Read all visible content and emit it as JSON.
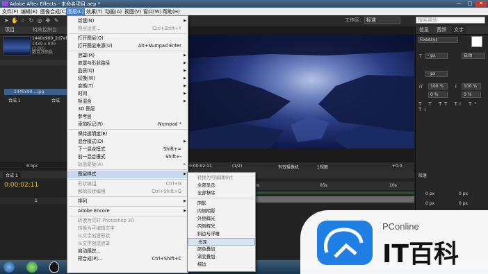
{
  "titlebar": {
    "title": "Adobe After Effects - 未命名项目.aep *",
    "min": "—",
    "max": "□",
    "close": "✕"
  },
  "menubar": {
    "items": [
      "文件(F)",
      "编辑(E)",
      "图像合成(C)",
      "图层(L)",
      "效果(T)",
      "动画(A)",
      "视图(V)",
      "窗口(W)",
      "帮助(H)"
    ]
  },
  "toolbar": {
    "workspace_label": "工作区:",
    "workspace_value": "标准",
    "search_placeholder": "搜索帮助"
  },
  "project": {
    "tab1": "项目",
    "tab2": "特效控制台",
    "file_name": "1440x900_2d7ef...",
    "file_info": "1439 x 900 (1.00)",
    "file_info2": "数百万颜色",
    "item1": "1440x90....jpg",
    "item2": "合成 1",
    "type1": "",
    "type2": "合成",
    "bpc": "8 bpc"
  },
  "viewer": {
    "zoom": "(1/2)",
    "camera": "有效摄像机",
    "views": "1视图",
    "time": "0:00:02:11",
    "offset": "+0.0"
  },
  "right_panel": {
    "tabs": [
      "信息",
      "音频",
      "文字"
    ],
    "font": "Fixedsys",
    "auto": "自动",
    "size_a": "- px",
    "size_b": "- px",
    "pct1": "100 %",
    "pct2": "100 %",
    "pct3": "0 %",
    "pct4": "0 %"
  },
  "timeline": {
    "tab": "合成 1",
    "time": "0:00:02:11",
    "layer_no": "1",
    "layer_mode": "正常",
    "ruler": [
      "0s",
      "05s",
      "10s"
    ],
    "right_tab": "段落",
    "right_values": [
      "0 px",
      "0 px",
      "0 px",
      "0 px"
    ]
  },
  "layer_menu": {
    "items": [
      {
        "label": "新建(N)",
        "sc": "",
        "arrow": true,
        "dis": false
      },
      {
        "label": "图层设置...",
        "sc": "Ctrl+Shift+Y",
        "arrow": false,
        "dis": true
      },
      {
        "sep": true
      },
      {
        "label": "打开图层(O)",
        "sc": "",
        "arrow": false,
        "dis": false
      },
      {
        "label": "打开图层来源(U)",
        "sc": "Alt+Numpad Enter",
        "arrow": false,
        "dis": false
      },
      {
        "sep": true
      },
      {
        "label": "遮罩(M)",
        "sc": "",
        "arrow": true,
        "dis": false
      },
      {
        "label": "遮罩与形状路径",
        "sc": "",
        "arrow": true,
        "dis": false
      },
      {
        "label": "品质(Q)",
        "sc": "",
        "arrow": true,
        "dis": false
      },
      {
        "label": "切换(W)",
        "sc": "",
        "arrow": true,
        "dis": false
      },
      {
        "label": "变换(T)",
        "sc": "",
        "arrow": true,
        "dis": false
      },
      {
        "label": "时间",
        "sc": "",
        "arrow": true,
        "dis": false
      },
      {
        "label": "帧混合",
        "sc": "",
        "arrow": true,
        "dis": false
      },
      {
        "label": "3D 图层",
        "sc": "",
        "arrow": false,
        "dis": false
      },
      {
        "label": "参考层",
        "sc": "",
        "arrow": false,
        "dis": false
      },
      {
        "label": "添加标记(R)",
        "sc": "Numpad *",
        "arrow": false,
        "dis": false
      },
      {
        "sep": true
      },
      {
        "label": "保持透明度(E)",
        "sc": "",
        "arrow": false,
        "dis": false
      },
      {
        "label": "混合模式(D)",
        "sc": "",
        "arrow": true,
        "dis": false
      },
      {
        "label": "下一混合模式",
        "sc": "Shift+=",
        "arrow": false,
        "dis": false
      },
      {
        "label": "前一混合模式",
        "sc": "Shift+-",
        "arrow": false,
        "dis": false
      },
      {
        "label": "轨道蒙板(A)",
        "sc": "",
        "arrow": true,
        "dis": true
      },
      {
        "sep": true
      },
      {
        "label": "图层样式",
        "sc": "",
        "arrow": true,
        "dis": false,
        "hl": true
      },
      {
        "sep": true
      },
      {
        "label": "形状编组",
        "sc": "Ctrl+G",
        "arrow": false,
        "dis": true
      },
      {
        "label": "解除形状编组",
        "sc": "Ctrl+Shift+G",
        "arrow": false,
        "dis": true
      },
      {
        "sep": true
      },
      {
        "label": "排列",
        "sc": "",
        "arrow": true,
        "dis": false
      },
      {
        "sep": true
      },
      {
        "label": "Adobe Encore",
        "sc": "",
        "arrow": true,
        "dis": false
      },
      {
        "sep": true
      },
      {
        "label": "转换为实时 Photoshop 3D",
        "sc": "",
        "arrow": false,
        "dis": true
      },
      {
        "label": "转换为可编辑文字",
        "sc": "",
        "arrow": false,
        "dis": true
      },
      {
        "label": "从文字创建形状",
        "sc": "",
        "arrow": false,
        "dis": true
      },
      {
        "label": "从文字创建遮罩",
        "sc": "",
        "arrow": false,
        "dis": true
      },
      {
        "label": "自动跟踪...",
        "sc": "",
        "arrow": false,
        "dis": false
      },
      {
        "label": "预合成(P)...",
        "sc": "Ctrl+Shift+C",
        "arrow": false,
        "dis": false
      }
    ]
  },
  "style_menu": {
    "items": [
      {
        "label": "转换为可编辑样式",
        "dis": true
      },
      {
        "label": "全部显示",
        "dis": false
      },
      {
        "label": "全部移除",
        "dis": false
      },
      {
        "sep": true
      },
      {
        "label": "阴影",
        "dis": false
      },
      {
        "label": "内侧阴影",
        "dis": false
      },
      {
        "label": "外侧辉光",
        "dis": false
      },
      {
        "label": "内侧辉光",
        "dis": false
      },
      {
        "label": "斜边与浮雕",
        "dis": false
      },
      {
        "label": "光泽",
        "dis": false,
        "hl": true
      },
      {
        "label": "颜色叠加",
        "dis": false
      },
      {
        "label": "渐变叠加",
        "dis": false
      },
      {
        "label": "描边",
        "dis": false
      }
    ]
  },
  "watermark": {
    "brand": "PConline",
    "name": "IT百科"
  }
}
